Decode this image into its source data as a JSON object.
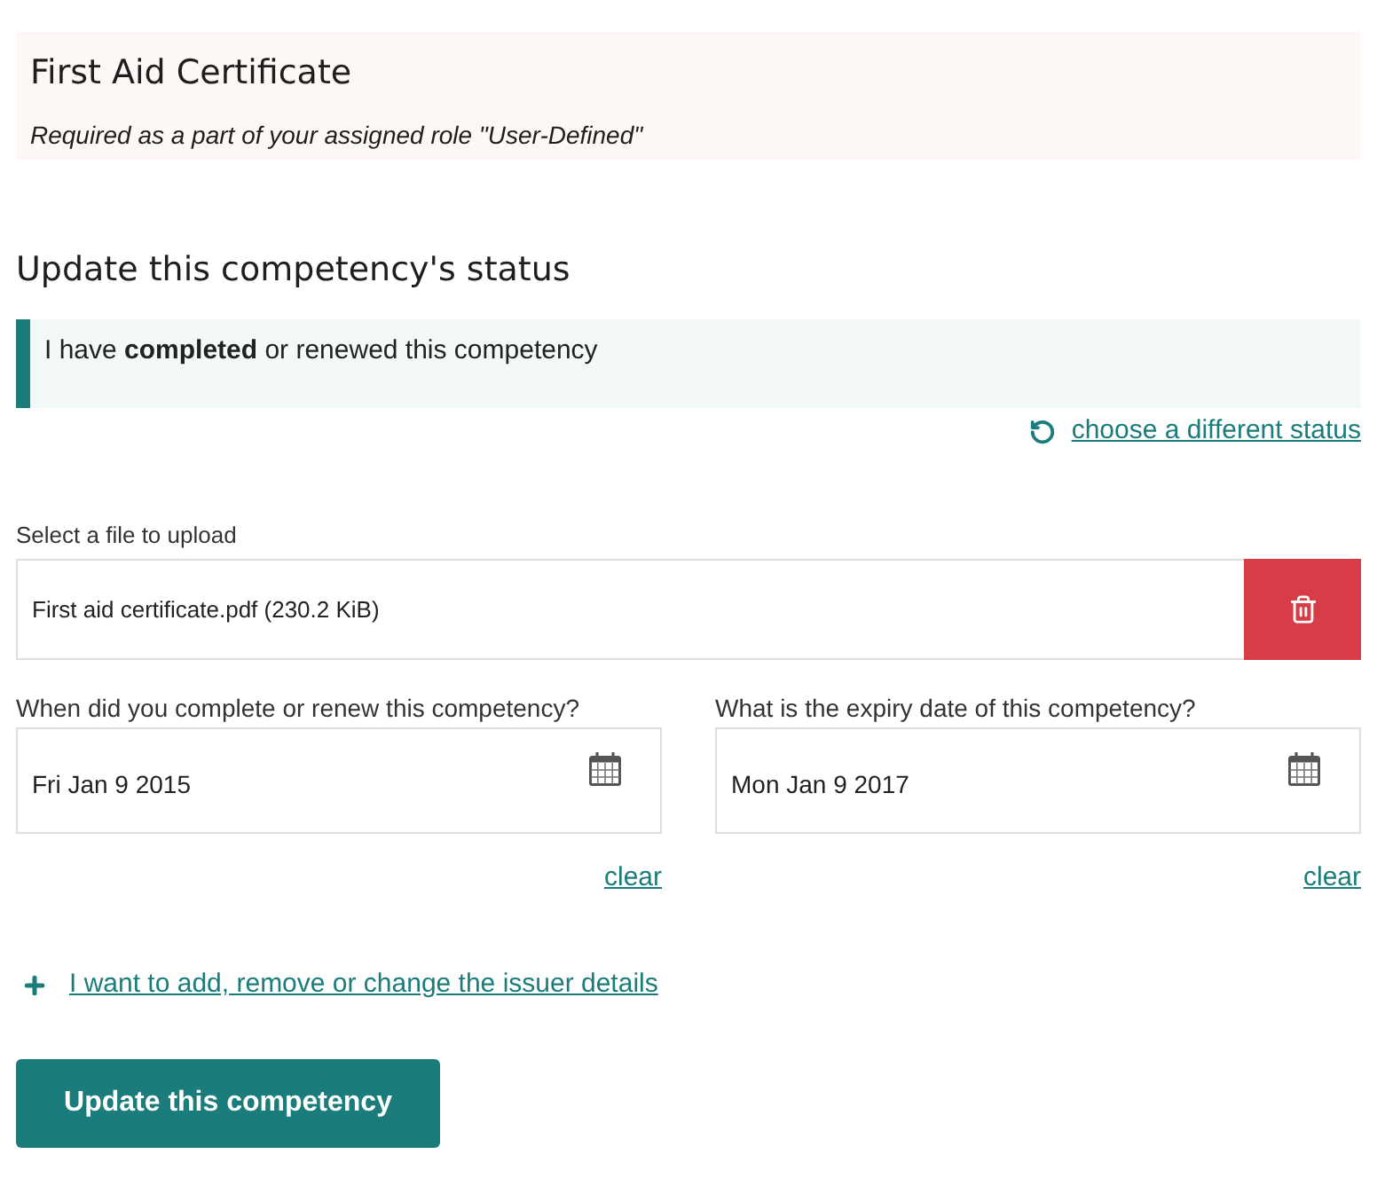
{
  "certificate": {
    "title": "First Aid Certificate",
    "requirement": "Required as a part of your assigned role \"User-Defined\""
  },
  "status_section": {
    "heading": "Update this competency's status",
    "status": "I have **completed** or renewed this competency",
    "change_link": "choose a different status"
  },
  "upload": {
    "label": "Select a file to upload",
    "file": "First aid certificate.pdf (230.2 KiB)"
  },
  "dates": [
    {
      "label": "When did you complete or renew this competency?",
      "value": "Fri Jan 9 2015",
      "clear_link": "clear"
    },
    {
      "label": "What is the expiry date of this competency?",
      "value": "Mon Jan 9 2017",
      "clear_link": "clear"
    }
  ],
  "issuer_link": "I want to add, remove or change the issuer details",
  "submit_button": "Update this competency"
}
